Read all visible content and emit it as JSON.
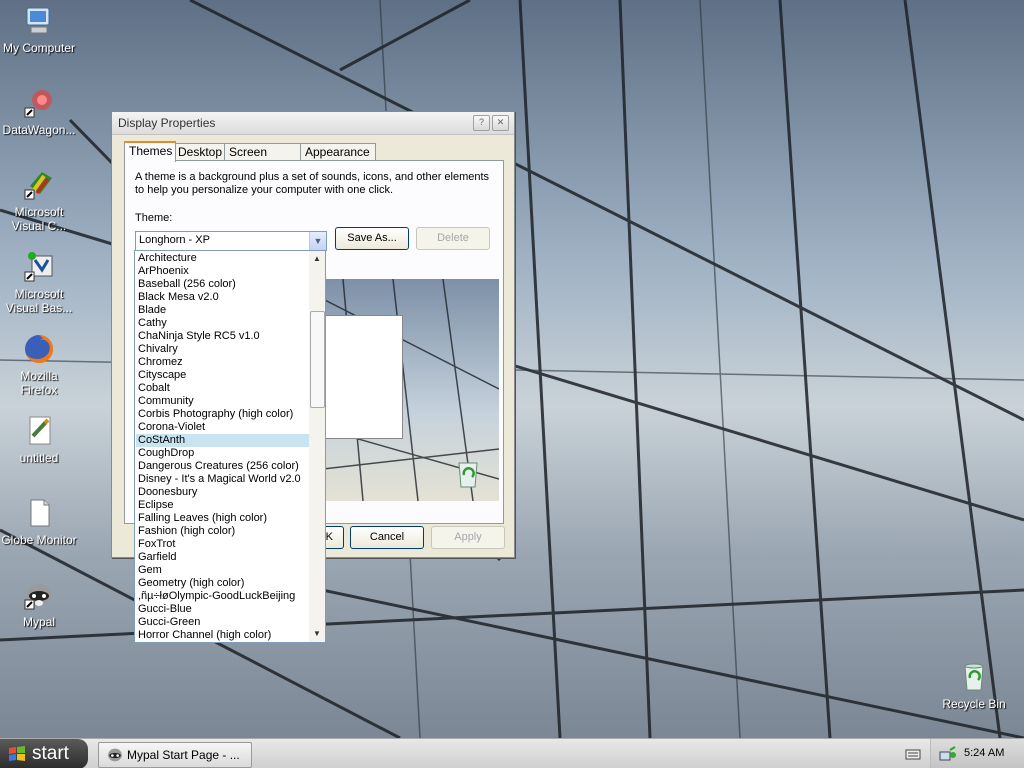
{
  "desktop": {
    "icons": [
      {
        "label": "My Computer",
        "icon": "my-computer-icon"
      },
      {
        "label": "DataWagon...",
        "icon": "datawagon-shortcut-icon"
      },
      {
        "label": "Microsoft Visual C...",
        "icon": "visual-c-shortcut-icon"
      },
      {
        "label": "Microsoft Visual Bas...",
        "icon": "visual-basic-shortcut-icon"
      },
      {
        "label": "Mozilla Firefox",
        "icon": "firefox-icon"
      },
      {
        "label": "untitled",
        "icon": "text-document-icon"
      },
      {
        "label": "Globe Monitor",
        "icon": "file-icon"
      },
      {
        "label": "Mypal",
        "icon": "mypal-raccoon-icon"
      },
      {
        "label": "Recycle Bin",
        "icon": "recycle-bin-icon"
      }
    ]
  },
  "window": {
    "title": "Display Properties",
    "title_buttons": [
      "?",
      "✕"
    ],
    "tabs": [
      "Themes",
      "Desktop",
      "Screen Saver",
      "Appearance"
    ],
    "active_tab": "Themes",
    "description": "A theme is a background plus a set of sounds, icons, and other elements to help you personalize your computer with one click.",
    "theme_label": "Theme:",
    "theme_value": "Longhorn - XP",
    "save_as": "Save As...",
    "delete": "Delete",
    "ok": "OK",
    "cancel": "Cancel",
    "apply": "Apply"
  },
  "dropdown": {
    "selected": "CoStAnth",
    "items": [
      "Architecture",
      "ArPhoenix",
      "Baseball (256 color)",
      "Black Mesa v2.0",
      "Blade",
      "Cathy",
      "ChaNinja Style RC5 v1.0",
      "Chivalry",
      "Chromez",
      "Cityscape",
      "Cobalt",
      "Community",
      "Corbis Photography (high color)",
      "Corona-Violet",
      "CoStAnth",
      "CoughDrop",
      "Dangerous Creatures (256 color)",
      "Disney - It's a Magical World v2.0",
      "Doonesbury",
      "Eclipse",
      "Falling Leaves (high color)",
      "Fashion (high color)",
      "FoxTrot",
      "Garfield",
      "Gem",
      "Geometry (high color)",
      ",ñµ÷łøOlympic-GoodLuckBeijing",
      "Gucci-Blue",
      "Gucci-Green",
      "Horror Channel (high color)"
    ]
  },
  "taskbar": {
    "start_label": "start",
    "tasks": [
      {
        "label": "Mypal Start Page - ...",
        "icon": "mypal-raccoon-icon"
      }
    ],
    "clock": "5:24 AM"
  }
}
